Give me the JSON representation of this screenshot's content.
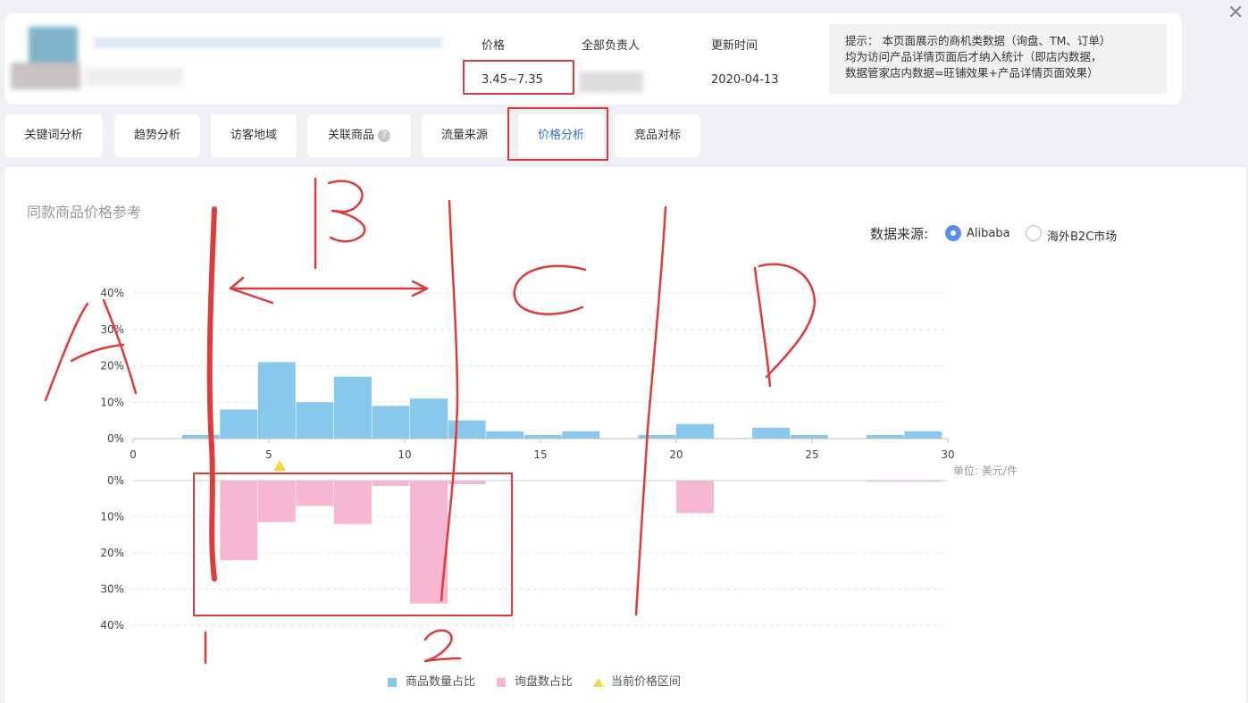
{
  "header": {
    "price_label": "价格",
    "price_value": "3.45~7.35",
    "owner_label": "全部负责人",
    "updated_label": "更新时间",
    "updated_value": "2020-04-13",
    "tip_lines": [
      "提示： 本页面展示的商机类数据（询盘、TM、订单）",
      "均为访问产品详情页面后才纳入统计（即店内数据，",
      "数据管家店内数据=旺铺效果+产品详情页面效果）"
    ]
  },
  "tabs": [
    {
      "label": "关键词分析",
      "active": false
    },
    {
      "label": "趋势分析",
      "active": false
    },
    {
      "label": "访客地域",
      "active": false
    },
    {
      "label": "关联商品",
      "active": false,
      "icon": "help-icon"
    },
    {
      "label": "流量来源",
      "active": false
    },
    {
      "label": "价格分析",
      "active": true
    },
    {
      "label": "竞品对标",
      "active": false
    }
  ],
  "section_title": "同款商品价格参考",
  "data_source": {
    "label": "数据来源:",
    "options": [
      {
        "label": "Alibaba",
        "selected": true
      },
      {
        "label": "海外B2C市场",
        "selected": false
      }
    ]
  },
  "annotations": {
    "letters": [
      "A",
      "B",
      "C",
      "D"
    ],
    "numbers": [
      "1",
      "2"
    ]
  },
  "colors": {
    "accent": "#2f6fd6",
    "highlight_red": "#e03b3b",
    "bar_top": "#87c8ec",
    "bar_bottom": "#f7b6d2",
    "marker": "#f5d742"
  },
  "chart_data": {
    "type": "bar",
    "x_range": [
      0,
      30
    ],
    "x_ticks": [
      "0",
      "5",
      "10",
      "15",
      "20",
      "25",
      "30"
    ],
    "unit_label": "单位: 美元/件",
    "y_ticks_top": [
      "0%",
      "10%",
      "20%",
      "30%",
      "40%"
    ],
    "y_ticks_bottom": [
      "0%",
      "10%",
      "20%",
      "30%",
      "40%"
    ],
    "ylim": [
      0,
      40
    ],
    "bin_width": 1.4,
    "bin_starts": [
      1.8,
      3.2,
      4.6,
      6.0,
      7.4,
      8.8,
      10.2,
      11.6,
      13.0,
      14.4,
      15.8,
      17.2,
      18.6,
      20.0,
      21.4,
      22.8,
      24.2,
      25.6,
      27.0,
      28.4
    ],
    "series": [
      {
        "name": "商品数量占比",
        "values": [
          1,
          8,
          21,
          10,
          17,
          9,
          11,
          5,
          2,
          1,
          2,
          0,
          1,
          4,
          0,
          3,
          1,
          0,
          1,
          2
        ]
      },
      {
        "name": "询盘数占比",
        "values": [
          0,
          22,
          11.5,
          7,
          12,
          1.5,
          34,
          1,
          0,
          0,
          0,
          0,
          0,
          9,
          0,
          0,
          0,
          0,
          0.3,
          0.3
        ]
      }
    ],
    "current_price_marker": 5.4,
    "legend": [
      {
        "name": "商品数量占比",
        "kind": "square"
      },
      {
        "name": "询盘数占比",
        "kind": "square"
      },
      {
        "name": "当前价格区间",
        "kind": "triangle"
      }
    ],
    "grid": true
  }
}
